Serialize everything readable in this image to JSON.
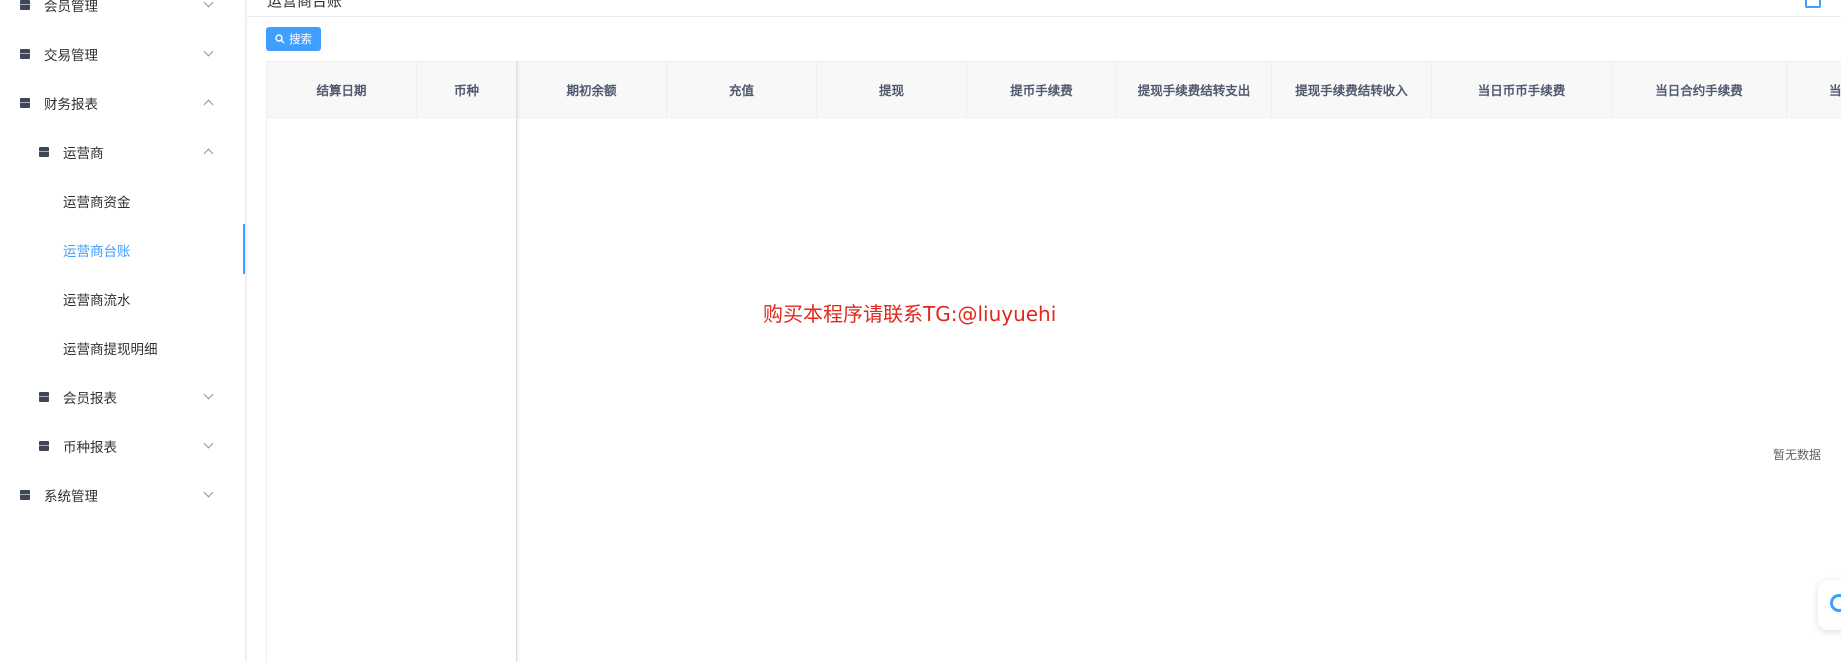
{
  "sidebar": {
    "items": [
      {
        "label": "会员管理",
        "arrow": "down"
      },
      {
        "label": "交易管理",
        "arrow": "down"
      },
      {
        "label": "财务报表",
        "arrow": "up"
      },
      {
        "label": "运营商",
        "arrow": "up"
      },
      {
        "label": "运营商资金"
      },
      {
        "label": "运营商台账",
        "active": true
      },
      {
        "label": "运营商流水"
      },
      {
        "label": "运营商提现明细"
      },
      {
        "label": "会员报表",
        "arrow": "down"
      },
      {
        "label": "币种报表",
        "arrow": "down"
      },
      {
        "label": "系统管理",
        "arrow": "down"
      }
    ]
  },
  "header": {
    "title": "运营商台账"
  },
  "toolbar": {
    "search_label": "搜索"
  },
  "table": {
    "columns": [
      "结算日期",
      "币种",
      "期初余额",
      "充值",
      "提现",
      "提币手续费",
      "提现手续费结转支出",
      "提现手续费结转收入",
      "当日币币手续费",
      "当日合约手续费",
      "当日"
    ],
    "empty_text": "暂无数据"
  },
  "watermark": "购买本程序请联系TG:@liuyuehi",
  "colors": {
    "accent": "#409eff",
    "watermark": "#e0281c"
  }
}
